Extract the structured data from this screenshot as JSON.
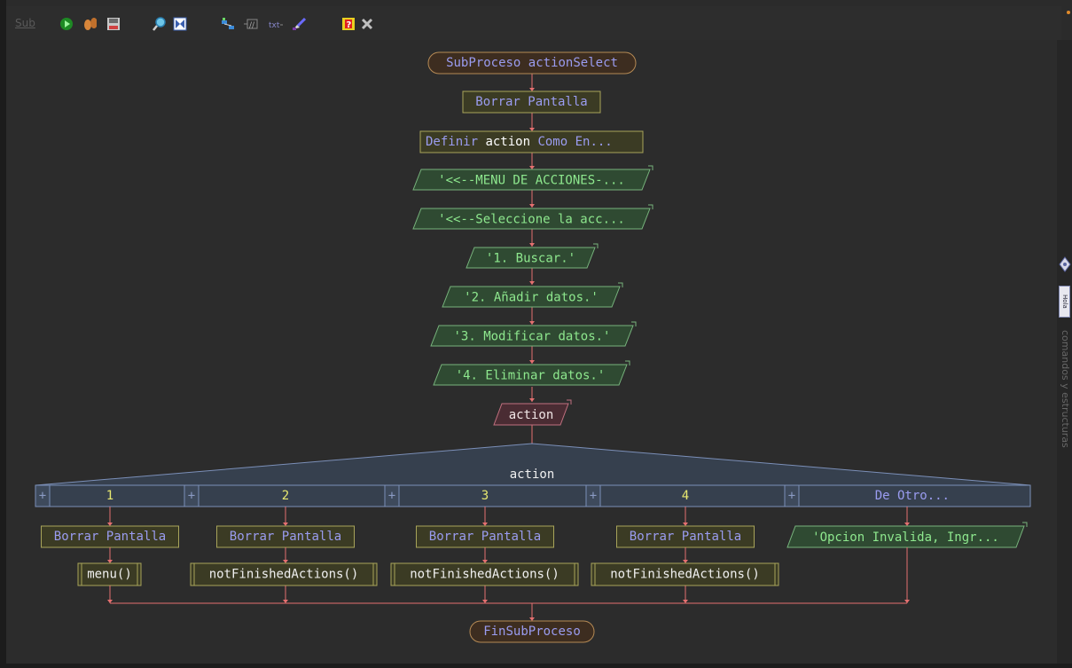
{
  "toolbar": {
    "label": "Sub",
    "icons": [
      "run-icon",
      "step-icon",
      "save-icon",
      "zoom-icon",
      "fit-icon",
      "styles-icon",
      "comment-icon",
      "color-icon",
      "brush-icon",
      "help-icon",
      "close-icon"
    ]
  },
  "side_panel": {
    "tab_label": "Hola",
    "text": "comandos y estructuras"
  },
  "flowchart": {
    "start": "SubProceso actionSelect",
    "clear": "Borrar Pantalla",
    "define_kw": "Definir",
    "define_var": "action",
    "define_rest": "Como En...",
    "out1": "'<<--MENU DE ACCIONES-...",
    "out2": "'<<--Seleccione la acc...",
    "out3": "'1. Buscar.'",
    "out4": "'2. Añadir datos.'",
    "out5": "'3. Modificar datos.'",
    "out6": "'4. Eliminar datos.'",
    "read": "action",
    "switch_var": "action",
    "case_plus": "+",
    "cases": [
      {
        "label": "1",
        "clear": "Borrar Pantalla",
        "call": "menu()"
      },
      {
        "label": "2",
        "clear": "Borrar Pantalla",
        "call": "notFinishedActions()"
      },
      {
        "label": "3",
        "clear": "Borrar Pantalla",
        "call": "notFinishedActions()"
      },
      {
        "label": "4",
        "clear": "Borrar Pantalla",
        "call": "notFinishedActions()"
      }
    ],
    "default_case": {
      "label": "De Otro...",
      "out": "'Opcion Invalida, Ingr..."
    },
    "end": "FinSubProceso"
  },
  "colors": {
    "canvas": "#2c2c2c",
    "line": "#e57070",
    "proc_fill": "#3b3b24",
    "proc_stroke": "#a8a45a",
    "proc_text": "#9a9cf0",
    "out_fill": "#2f4a32",
    "out_stroke": "#77b37c",
    "out_text": "#8ee88e",
    "in_fill": "#4a2c33",
    "in_stroke": "#c0707f",
    "in_text": "#f0e6e6",
    "term_fill": "#3d2d20",
    "term_stroke": "#b58a55",
    "switch_fill": "#36404e",
    "switch_stroke": "#7b8fb8",
    "case_text": "#e8e870",
    "default_text": "#9a9cf0"
  }
}
